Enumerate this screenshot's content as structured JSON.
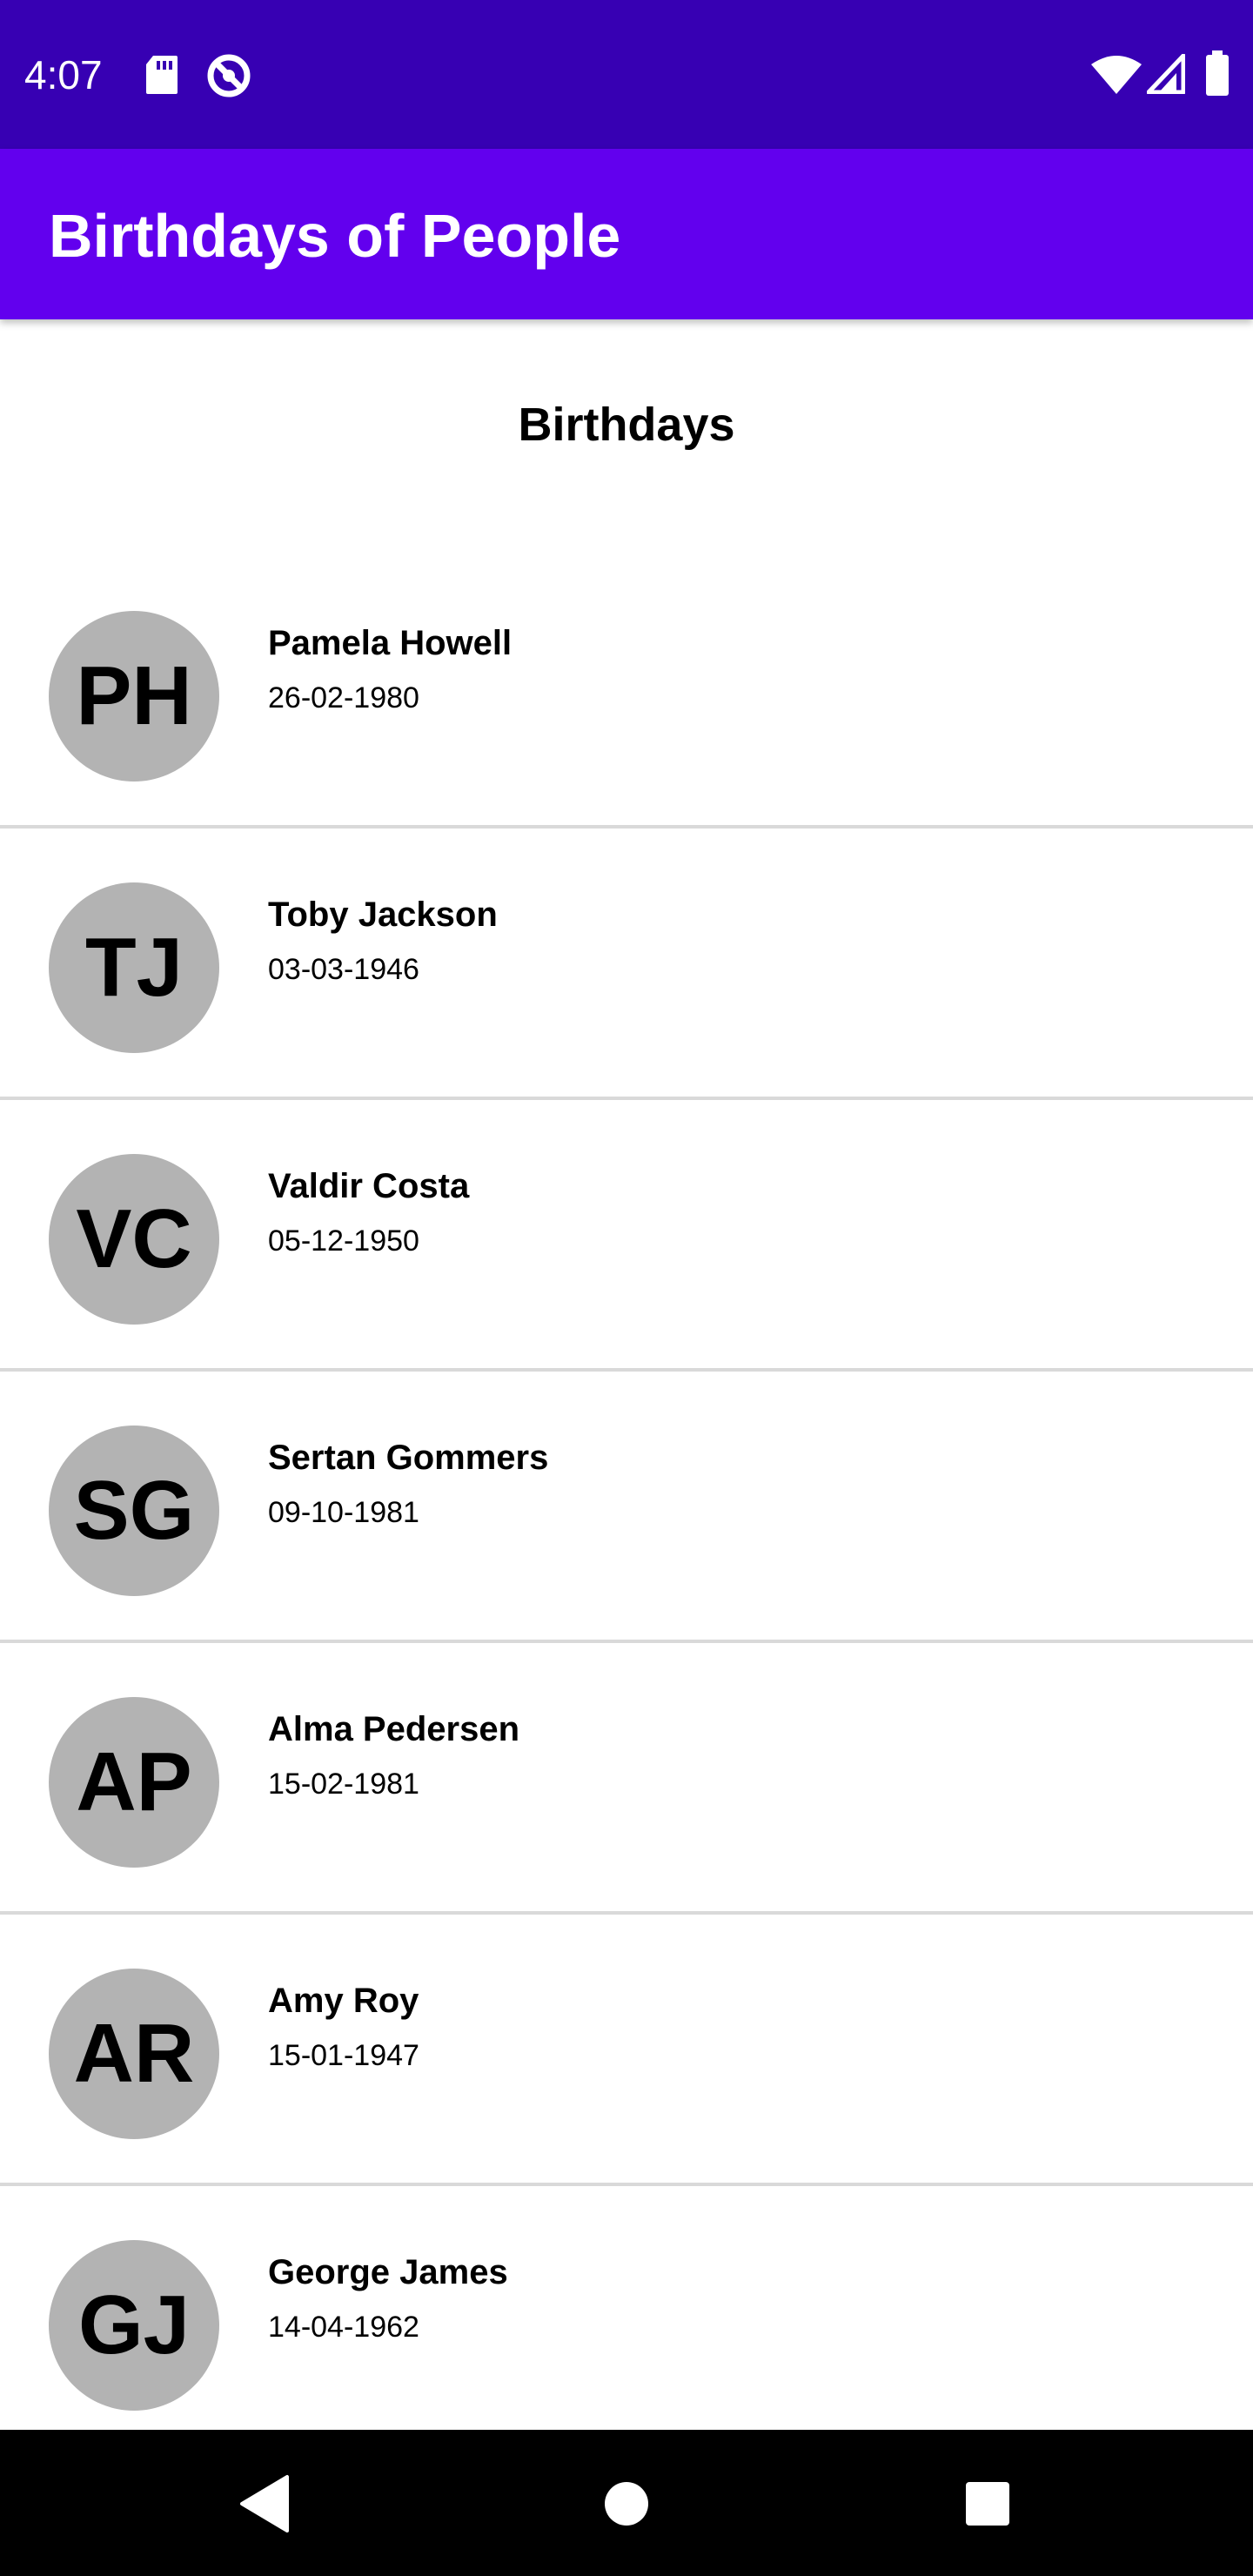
{
  "status_bar": {
    "time": "4:07",
    "icons": [
      "sd-card-icon",
      "no-sync-icon",
      "wifi-icon",
      "signal-icon",
      "battery-icon"
    ]
  },
  "app_bar": {
    "title": "Birthdays of People",
    "color": "#6200ee",
    "status_color": "#3700b3"
  },
  "main": {
    "heading": "Birthdays",
    "people": [
      {
        "initials": "PH",
        "name": "Pamela Howell",
        "date": "26-02-1980"
      },
      {
        "initials": "TJ",
        "name": "Toby Jackson",
        "date": "03-03-1946"
      },
      {
        "initials": "VC",
        "name": "Valdir Costa",
        "date": "05-12-1950"
      },
      {
        "initials": "SG",
        "name": "Sertan Gommers",
        "date": "09-10-1981"
      },
      {
        "initials": "AP",
        "name": "Alma Pedersen",
        "date": "15-02-1981"
      },
      {
        "initials": "AR",
        "name": "Amy Roy",
        "date": "15-01-1947"
      },
      {
        "initials": "GJ",
        "name": "George James",
        "date": "14-04-1962"
      }
    ]
  },
  "nav_bar": {
    "buttons": [
      "back-icon",
      "home-icon",
      "recents-icon"
    ]
  }
}
